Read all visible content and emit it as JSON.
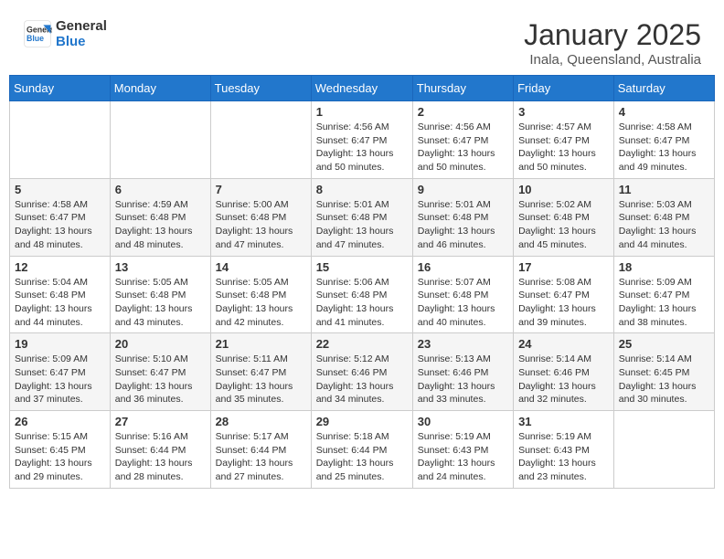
{
  "header": {
    "logo_line1": "General",
    "logo_line2": "Blue",
    "month": "January 2025",
    "location": "Inala, Queensland, Australia"
  },
  "weekdays": [
    "Sunday",
    "Monday",
    "Tuesday",
    "Wednesday",
    "Thursday",
    "Friday",
    "Saturday"
  ],
  "weeks": [
    [
      {
        "day": "",
        "info": ""
      },
      {
        "day": "",
        "info": ""
      },
      {
        "day": "",
        "info": ""
      },
      {
        "day": "1",
        "info": "Sunrise: 4:56 AM\nSunset: 6:47 PM\nDaylight: 13 hours\nand 50 minutes."
      },
      {
        "day": "2",
        "info": "Sunrise: 4:56 AM\nSunset: 6:47 PM\nDaylight: 13 hours\nand 50 minutes."
      },
      {
        "day": "3",
        "info": "Sunrise: 4:57 AM\nSunset: 6:47 PM\nDaylight: 13 hours\nand 50 minutes."
      },
      {
        "day": "4",
        "info": "Sunrise: 4:58 AM\nSunset: 6:47 PM\nDaylight: 13 hours\nand 49 minutes."
      }
    ],
    [
      {
        "day": "5",
        "info": "Sunrise: 4:58 AM\nSunset: 6:47 PM\nDaylight: 13 hours\nand 48 minutes."
      },
      {
        "day": "6",
        "info": "Sunrise: 4:59 AM\nSunset: 6:48 PM\nDaylight: 13 hours\nand 48 minutes."
      },
      {
        "day": "7",
        "info": "Sunrise: 5:00 AM\nSunset: 6:48 PM\nDaylight: 13 hours\nand 47 minutes."
      },
      {
        "day": "8",
        "info": "Sunrise: 5:01 AM\nSunset: 6:48 PM\nDaylight: 13 hours\nand 47 minutes."
      },
      {
        "day": "9",
        "info": "Sunrise: 5:01 AM\nSunset: 6:48 PM\nDaylight: 13 hours\nand 46 minutes."
      },
      {
        "day": "10",
        "info": "Sunrise: 5:02 AM\nSunset: 6:48 PM\nDaylight: 13 hours\nand 45 minutes."
      },
      {
        "day": "11",
        "info": "Sunrise: 5:03 AM\nSunset: 6:48 PM\nDaylight: 13 hours\nand 44 minutes."
      }
    ],
    [
      {
        "day": "12",
        "info": "Sunrise: 5:04 AM\nSunset: 6:48 PM\nDaylight: 13 hours\nand 44 minutes."
      },
      {
        "day": "13",
        "info": "Sunrise: 5:05 AM\nSunset: 6:48 PM\nDaylight: 13 hours\nand 43 minutes."
      },
      {
        "day": "14",
        "info": "Sunrise: 5:05 AM\nSunset: 6:48 PM\nDaylight: 13 hours\nand 42 minutes."
      },
      {
        "day": "15",
        "info": "Sunrise: 5:06 AM\nSunset: 6:48 PM\nDaylight: 13 hours\nand 41 minutes."
      },
      {
        "day": "16",
        "info": "Sunrise: 5:07 AM\nSunset: 6:48 PM\nDaylight: 13 hours\nand 40 minutes."
      },
      {
        "day": "17",
        "info": "Sunrise: 5:08 AM\nSunset: 6:47 PM\nDaylight: 13 hours\nand 39 minutes."
      },
      {
        "day": "18",
        "info": "Sunrise: 5:09 AM\nSunset: 6:47 PM\nDaylight: 13 hours\nand 38 minutes."
      }
    ],
    [
      {
        "day": "19",
        "info": "Sunrise: 5:09 AM\nSunset: 6:47 PM\nDaylight: 13 hours\nand 37 minutes."
      },
      {
        "day": "20",
        "info": "Sunrise: 5:10 AM\nSunset: 6:47 PM\nDaylight: 13 hours\nand 36 minutes."
      },
      {
        "day": "21",
        "info": "Sunrise: 5:11 AM\nSunset: 6:47 PM\nDaylight: 13 hours\nand 35 minutes."
      },
      {
        "day": "22",
        "info": "Sunrise: 5:12 AM\nSunset: 6:46 PM\nDaylight: 13 hours\nand 34 minutes."
      },
      {
        "day": "23",
        "info": "Sunrise: 5:13 AM\nSunset: 6:46 PM\nDaylight: 13 hours\nand 33 minutes."
      },
      {
        "day": "24",
        "info": "Sunrise: 5:14 AM\nSunset: 6:46 PM\nDaylight: 13 hours\nand 32 minutes."
      },
      {
        "day": "25",
        "info": "Sunrise: 5:14 AM\nSunset: 6:45 PM\nDaylight: 13 hours\nand 30 minutes."
      }
    ],
    [
      {
        "day": "26",
        "info": "Sunrise: 5:15 AM\nSunset: 6:45 PM\nDaylight: 13 hours\nand 29 minutes."
      },
      {
        "day": "27",
        "info": "Sunrise: 5:16 AM\nSunset: 6:44 PM\nDaylight: 13 hours\nand 28 minutes."
      },
      {
        "day": "28",
        "info": "Sunrise: 5:17 AM\nSunset: 6:44 PM\nDaylight: 13 hours\nand 27 minutes."
      },
      {
        "day": "29",
        "info": "Sunrise: 5:18 AM\nSunset: 6:44 PM\nDaylight: 13 hours\nand 25 minutes."
      },
      {
        "day": "30",
        "info": "Sunrise: 5:19 AM\nSunset: 6:43 PM\nDaylight: 13 hours\nand 24 minutes."
      },
      {
        "day": "31",
        "info": "Sunrise: 5:19 AM\nSunset: 6:43 PM\nDaylight: 13 hours\nand 23 minutes."
      },
      {
        "day": "",
        "info": ""
      }
    ]
  ]
}
